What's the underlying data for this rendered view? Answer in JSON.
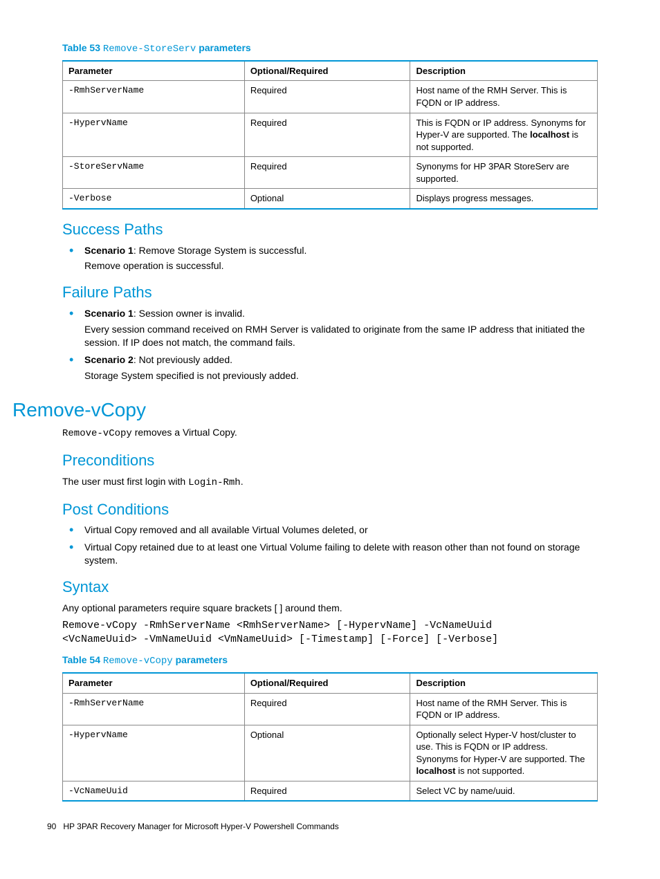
{
  "table53": {
    "caption_prefix": "Table 53 ",
    "caption_cmd": "Remove-StoreServ",
    "caption_suffix": " parameters",
    "headers": [
      "Parameter",
      "Optional/Required",
      "Description"
    ],
    "rows": [
      {
        "param": "-RmhServerName",
        "req": "Required",
        "desc_pre": "Host name of the RMH Server. This is FQDN or IP address.",
        "bold": "",
        "desc_post": ""
      },
      {
        "param": "-HypervName",
        "req": "Required",
        "desc_pre": "This is FQDN or IP address. Synonyms for Hyper-V are supported. The ",
        "bold": "localhost",
        "desc_post": " is not supported."
      },
      {
        "param": "-StoreServName",
        "req": "Required",
        "desc_pre": "Synonyms for HP 3PAR StoreServ are supported.",
        "bold": "",
        "desc_post": ""
      },
      {
        "param": "-Verbose",
        "req": "Optional",
        "desc_pre": "Displays progress messages.",
        "bold": "",
        "desc_post": ""
      }
    ]
  },
  "success": {
    "heading": "Success Paths",
    "s1_title": "Scenario 1",
    "s1_rest": ": Remove Storage System is successful.",
    "s1_sub": "Remove operation is successful."
  },
  "failure": {
    "heading": "Failure Paths",
    "s1_title": "Scenario 1",
    "s1_rest": ": Session owner is invalid.",
    "s1_sub": "Every session command received on RMH Server is validated to originate from the same IP address that initiated the session. If IP does not match, the command fails.",
    "s2_title": "Scenario 2",
    "s2_rest": ": Not previously added.",
    "s2_sub": "Storage System specified is not previously added."
  },
  "removevcopy": {
    "heading": "Remove-vCopy",
    "intro_cmd": "Remove-vCopy",
    "intro_rest": " removes a Virtual Copy."
  },
  "preconditions": {
    "heading": "Preconditions",
    "text_pre": "The user must first login with ",
    "text_cmd": "Login-Rmh",
    "text_post": "."
  },
  "postconditions": {
    "heading": "Post Conditions",
    "b1": "Virtual Copy removed and all available Virtual Volumes deleted, or",
    "b2": "Virtual Copy retained due to at least one Virtual Volume failing to delete with reason other than not found on storage system."
  },
  "syntax": {
    "heading": "Syntax",
    "text": "Any optional parameters require square brackets [ ] around them.",
    "code": "Remove-vCopy -RmhServerName <RmhServerName> [-HypervName] -VcNameUuid\n<VcNameUuid> -VmNameUuid <VmNameUuid> [-Timestamp] [-Force] [-Verbose]"
  },
  "table54": {
    "caption_prefix": "Table 54 ",
    "caption_cmd": "Remove-vCopy",
    "caption_suffix": " parameters",
    "headers": [
      "Parameter",
      "Optional/Required",
      "Description"
    ],
    "rows": [
      {
        "param": "-RmhServerName",
        "req": "Required",
        "desc_pre": "Host name of the RMH Server. This is FQDN or IP address.",
        "bold": "",
        "desc_post": ""
      },
      {
        "param": "-HypervName",
        "req": "Optional",
        "desc_pre": "Optionally select Hyper-V host/cluster to use. This is FQDN or IP address. Synonyms for Hyper-V are supported. The ",
        "bold": "localhost",
        "desc_post": " is not supported."
      },
      {
        "param": "-VcNameUuid",
        "req": "Required",
        "desc_pre": "Select VC by name/uuid.",
        "bold": "",
        "desc_post": ""
      }
    ]
  },
  "footer": {
    "page": "90",
    "title": "HP 3PAR Recovery Manager for Microsoft Hyper-V Powershell Commands"
  }
}
